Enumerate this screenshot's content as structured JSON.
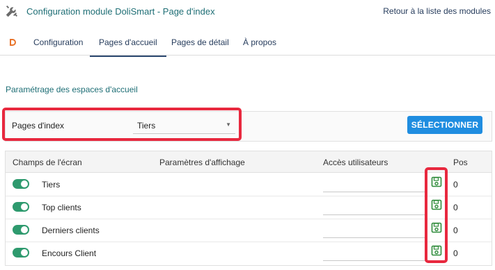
{
  "header": {
    "title": "Configuration module DoliSmart - Page d'index",
    "back_link": "Retour à la liste des modules"
  },
  "tabs": [
    {
      "label": "Configuration"
    },
    {
      "label": "Pages d'accueil"
    },
    {
      "label": "Pages de détail"
    },
    {
      "label": "À propos"
    }
  ],
  "section": {
    "title": "Paramétrage des espaces d'accueil"
  },
  "filter": {
    "label": "Pages d'index",
    "selected": "Tiers",
    "button_label": "SÉLECTIONNER"
  },
  "table": {
    "columns": [
      "Champs de l'écran",
      "Paramètres d'affichage",
      "Accès utilisateurs",
      "Pos"
    ],
    "rows": [
      {
        "label": "Tiers",
        "enabled": true,
        "pos": "0"
      },
      {
        "label": "Top clients",
        "enabled": true,
        "pos": "0"
      },
      {
        "label": "Derniers clients",
        "enabled": true,
        "pos": "0"
      },
      {
        "label": "Encours Client",
        "enabled": true,
        "pos": "0"
      }
    ]
  },
  "colors": {
    "accent": "#1e6e75",
    "button": "#1f8de0",
    "toggle": "#2e9a6e",
    "highlight": "#e8283e",
    "save_icon": "#2e8b3a"
  },
  "icons": [
    "tools-icon",
    "dolismart-logo-icon",
    "save-icon"
  ]
}
